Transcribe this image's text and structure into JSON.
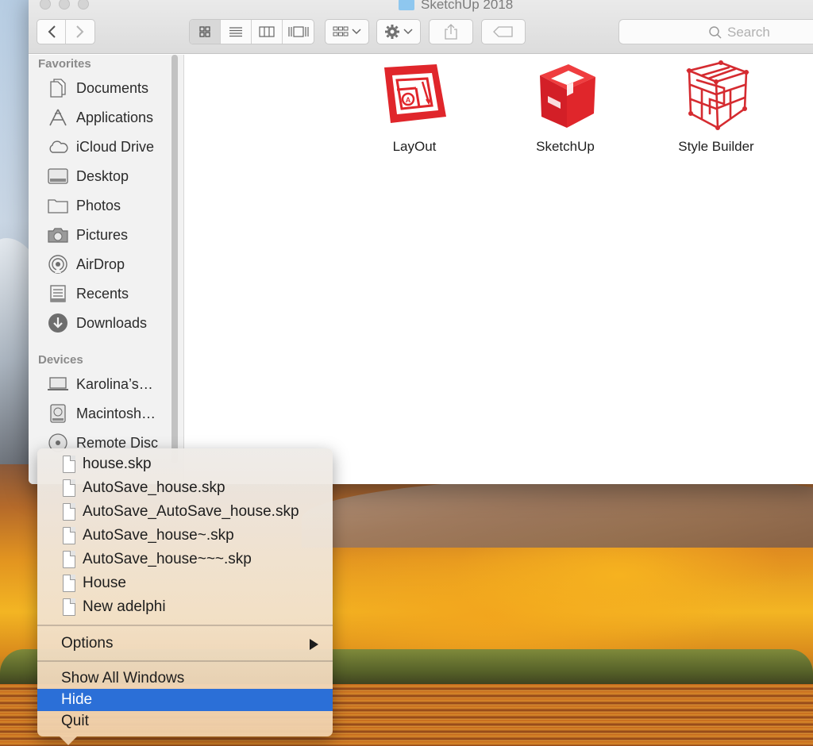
{
  "window": {
    "title": "SketchUp 2018",
    "search_placeholder": "Search"
  },
  "sidebar": {
    "favorites_heading": "Favorites",
    "favorites": [
      {
        "label": "Documents",
        "icon": "documents-icon"
      },
      {
        "label": "Applications",
        "icon": "applications-icon"
      },
      {
        "label": "iCloud Drive",
        "icon": "icloud-icon"
      },
      {
        "label": "Desktop",
        "icon": "desktop-icon"
      },
      {
        "label": "Photos",
        "icon": "folder-icon"
      },
      {
        "label": "Pictures",
        "icon": "camera-icon"
      },
      {
        "label": "AirDrop",
        "icon": "airdrop-icon"
      },
      {
        "label": "Recents",
        "icon": "recents-icon"
      },
      {
        "label": "Downloads",
        "icon": "downloads-icon"
      }
    ],
    "devices_heading": "Devices",
    "devices": [
      {
        "label": "Karolina’s…",
        "icon": "laptop-icon"
      },
      {
        "label": "Macintosh…",
        "icon": "hard-drive-icon"
      },
      {
        "label": "Remote Disc",
        "icon": "remote-disc-icon"
      }
    ]
  },
  "content": {
    "apps": [
      {
        "label": "LayOut",
        "icon": "layout-app-icon"
      },
      {
        "label": "SketchUp",
        "icon": "sketchup-app-icon"
      },
      {
        "label": "Style Builder",
        "icon": "style-builder-app-icon"
      }
    ]
  },
  "menu": {
    "recent_files": [
      "house.skp",
      "AutoSave_house.skp",
      "AutoSave_AutoSave_house.skp",
      "AutoSave_house~.skp",
      "AutoSave_house~~~.skp",
      "House",
      "New adelphi"
    ],
    "options": "Options",
    "show_all_windows": "Show All Windows",
    "hide": "Hide",
    "quit": "Quit",
    "highlighted_item": "Hide"
  },
  "colors": {
    "sketchup_red": "#e0262b",
    "menu_highlight": "#2b6fd7",
    "folder_blue": "#8ec7ef"
  }
}
